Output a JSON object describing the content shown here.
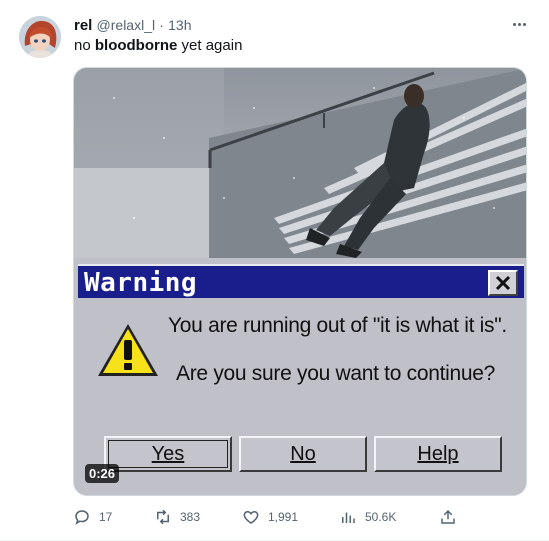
{
  "tweet": {
    "display_name": "rel",
    "handle": "@relaxl_l",
    "separator": "·",
    "time_ago": "13h",
    "text_before": "no ",
    "text_bold": "bloodborne",
    "text_after": " yet again"
  },
  "media": {
    "dialog_title": "Warning",
    "message_line1": "You are running out of \"it is what it is\".",
    "message_line2": "Are you sure you want to continue?",
    "buttons": [
      "Yes",
      "No",
      "Help"
    ],
    "video_time": "0:26"
  },
  "actions": {
    "replies": "17",
    "reposts": "383",
    "likes": "1,991",
    "views": "50.6K"
  },
  "colors": {
    "text": "#0f1419",
    "secondary_text": "#536471",
    "dialog_titlebar": "#1a1e8c",
    "dialog_body": "#c0c0c8"
  },
  "icons": [
    "more-icon",
    "close-icon",
    "warning-icon",
    "reply-icon",
    "repost-icon",
    "like-icon",
    "views-icon",
    "share-icon"
  ]
}
